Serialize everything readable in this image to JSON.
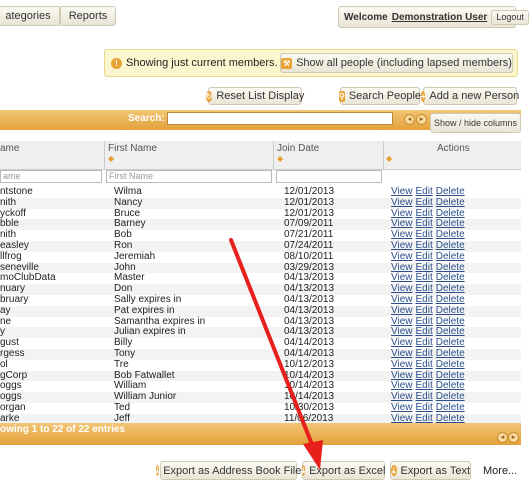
{
  "nav": {
    "categories": "ategories",
    "reports": "Reports"
  },
  "user": {
    "welcome": "Welcome",
    "name": "Demonstration User",
    "logout": "Logout"
  },
  "notice": {
    "text": "Showing just current members.",
    "button": "Show all people (including lapsed members)"
  },
  "toolbar": {
    "reset": "Reset List Display",
    "search_people": "Search People",
    "add_person": "Add a new Person"
  },
  "table": {
    "search_label": "Search:",
    "search_value": "",
    "show_hide": "Show / hide columns",
    "headers": [
      "ame",
      "First Name",
      "Join Date",
      "Actions"
    ],
    "filter_placeholders": [
      "ame",
      "First Name"
    ],
    "actions": [
      "View",
      "Edit",
      "Delete"
    ],
    "rows": [
      [
        "ntstone",
        "Wilma",
        "12/01/2013"
      ],
      [
        "nith",
        "Nancy",
        "12/01/2013"
      ],
      [
        "yckoff",
        "Bruce",
        "12/01/2013"
      ],
      [
        "bble",
        "Barney",
        "07/09/2011"
      ],
      [
        "nith",
        "Bob",
        "07/21/2011"
      ],
      [
        "easley",
        "Ron",
        "07/24/2011"
      ],
      [
        "llfrog",
        "Jeremiah",
        "08/10/2011"
      ],
      [
        "seneville",
        "John",
        "03/29/2013"
      ],
      [
        "moClubData",
        "Master",
        "04/13/2013"
      ],
      [
        "nuary",
        "Don",
        "04/13/2013"
      ],
      [
        "bruary",
        "Sally expires in",
        "04/13/2013"
      ],
      [
        "ay",
        "Pat expires in",
        "04/13/2013"
      ],
      [
        "ne",
        "Samantha expires in",
        "04/13/2013"
      ],
      [
        "y",
        "Julian expires in",
        "04/13/2013"
      ],
      [
        "gust",
        "Billy",
        "04/14/2013"
      ],
      [
        "rgess",
        "Tony",
        "04/14/2013"
      ],
      [
        "ol",
        "Tre",
        "10/12/2013"
      ],
      [
        "gCorp",
        "Bob Fatwallet",
        "10/14/2013"
      ],
      [
        "oggs",
        "William",
        "10/14/2013"
      ],
      [
        "oggs",
        "William Junior",
        "10/14/2013"
      ],
      [
        "organ",
        "Ted",
        "10/30/2013"
      ],
      [
        "arke",
        "Jeff",
        "11/06/2013"
      ]
    ],
    "footer": "owing 1 to 22 of 22 entries"
  },
  "export": {
    "address_book": "Export as Address Book File",
    "excel": "Export as Excel",
    "text": "Export as Text",
    "more": "More..."
  },
  "colors": {
    "accent": "#e3a23b",
    "annotation_arrow": "#e8201c"
  }
}
